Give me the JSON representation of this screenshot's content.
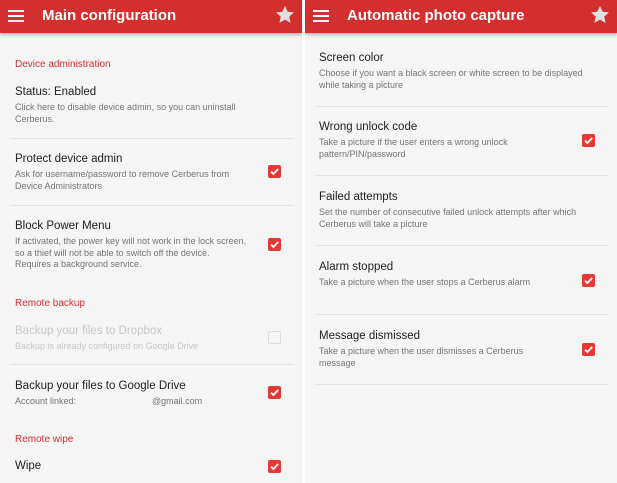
{
  "left": {
    "title": "Main configuration",
    "sections": {
      "device_admin": "Device administration",
      "remote_backup": "Remote backup",
      "remote_wipe": "Remote wipe"
    },
    "items": {
      "status": {
        "title": "Status: Enabled",
        "summary": "Click here to disable device admin, so you can uninstall Cerberus."
      },
      "protect": {
        "title": "Protect device admin",
        "summary": "Ask for username/password to remove Cerberus from Device Administrators",
        "checked": true
      },
      "power": {
        "title": "Block Power Menu",
        "summary": "If activated, the power key will not work in the lock screen, so a thief will not be able to switch off the device. Requires a background service.",
        "checked": true
      },
      "dropbox": {
        "title": "Backup your files to Dropbox",
        "summary": "Backup is already configured on Google Drive",
        "checked": false,
        "enabled": false
      },
      "gdrive": {
        "title": "Backup your files to Google Drive",
        "summary_label": "Account linked:",
        "summary_value": "@gmail.com",
        "checked": true
      },
      "wipe": {
        "title": "Wipe",
        "checked": true
      }
    }
  },
  "right": {
    "title": "Automatic photo capture",
    "items": {
      "screen_color": {
        "title": "Screen color",
        "summary": "Choose if you want a black screen or white screen to be displayed while taking a picture"
      },
      "wrong_code": {
        "title": "Wrong unlock code",
        "summary": "Take a picture if the user enters a wrong unlock pattern/PIN/password",
        "checked": true
      },
      "failed": {
        "title": "Failed attempts",
        "summary": "Set the number of consecutive failed unlock attempts after which Cerberus will take a picture"
      },
      "alarm": {
        "title": "Alarm stopped",
        "summary": "Take a picture when the user stops a Cerberus alarm",
        "checked": true
      },
      "message": {
        "title": "Message dismissed",
        "summary": "Take a picture when the user dismisses a Cerberus message",
        "checked": true
      }
    }
  },
  "icons": {
    "menu": "menu-icon",
    "star": "star-icon",
    "checkbox": "check-icon"
  },
  "colors": {
    "accent": "#d32f2f",
    "checkbox": "#e53935",
    "background": "#f5f5f5"
  }
}
